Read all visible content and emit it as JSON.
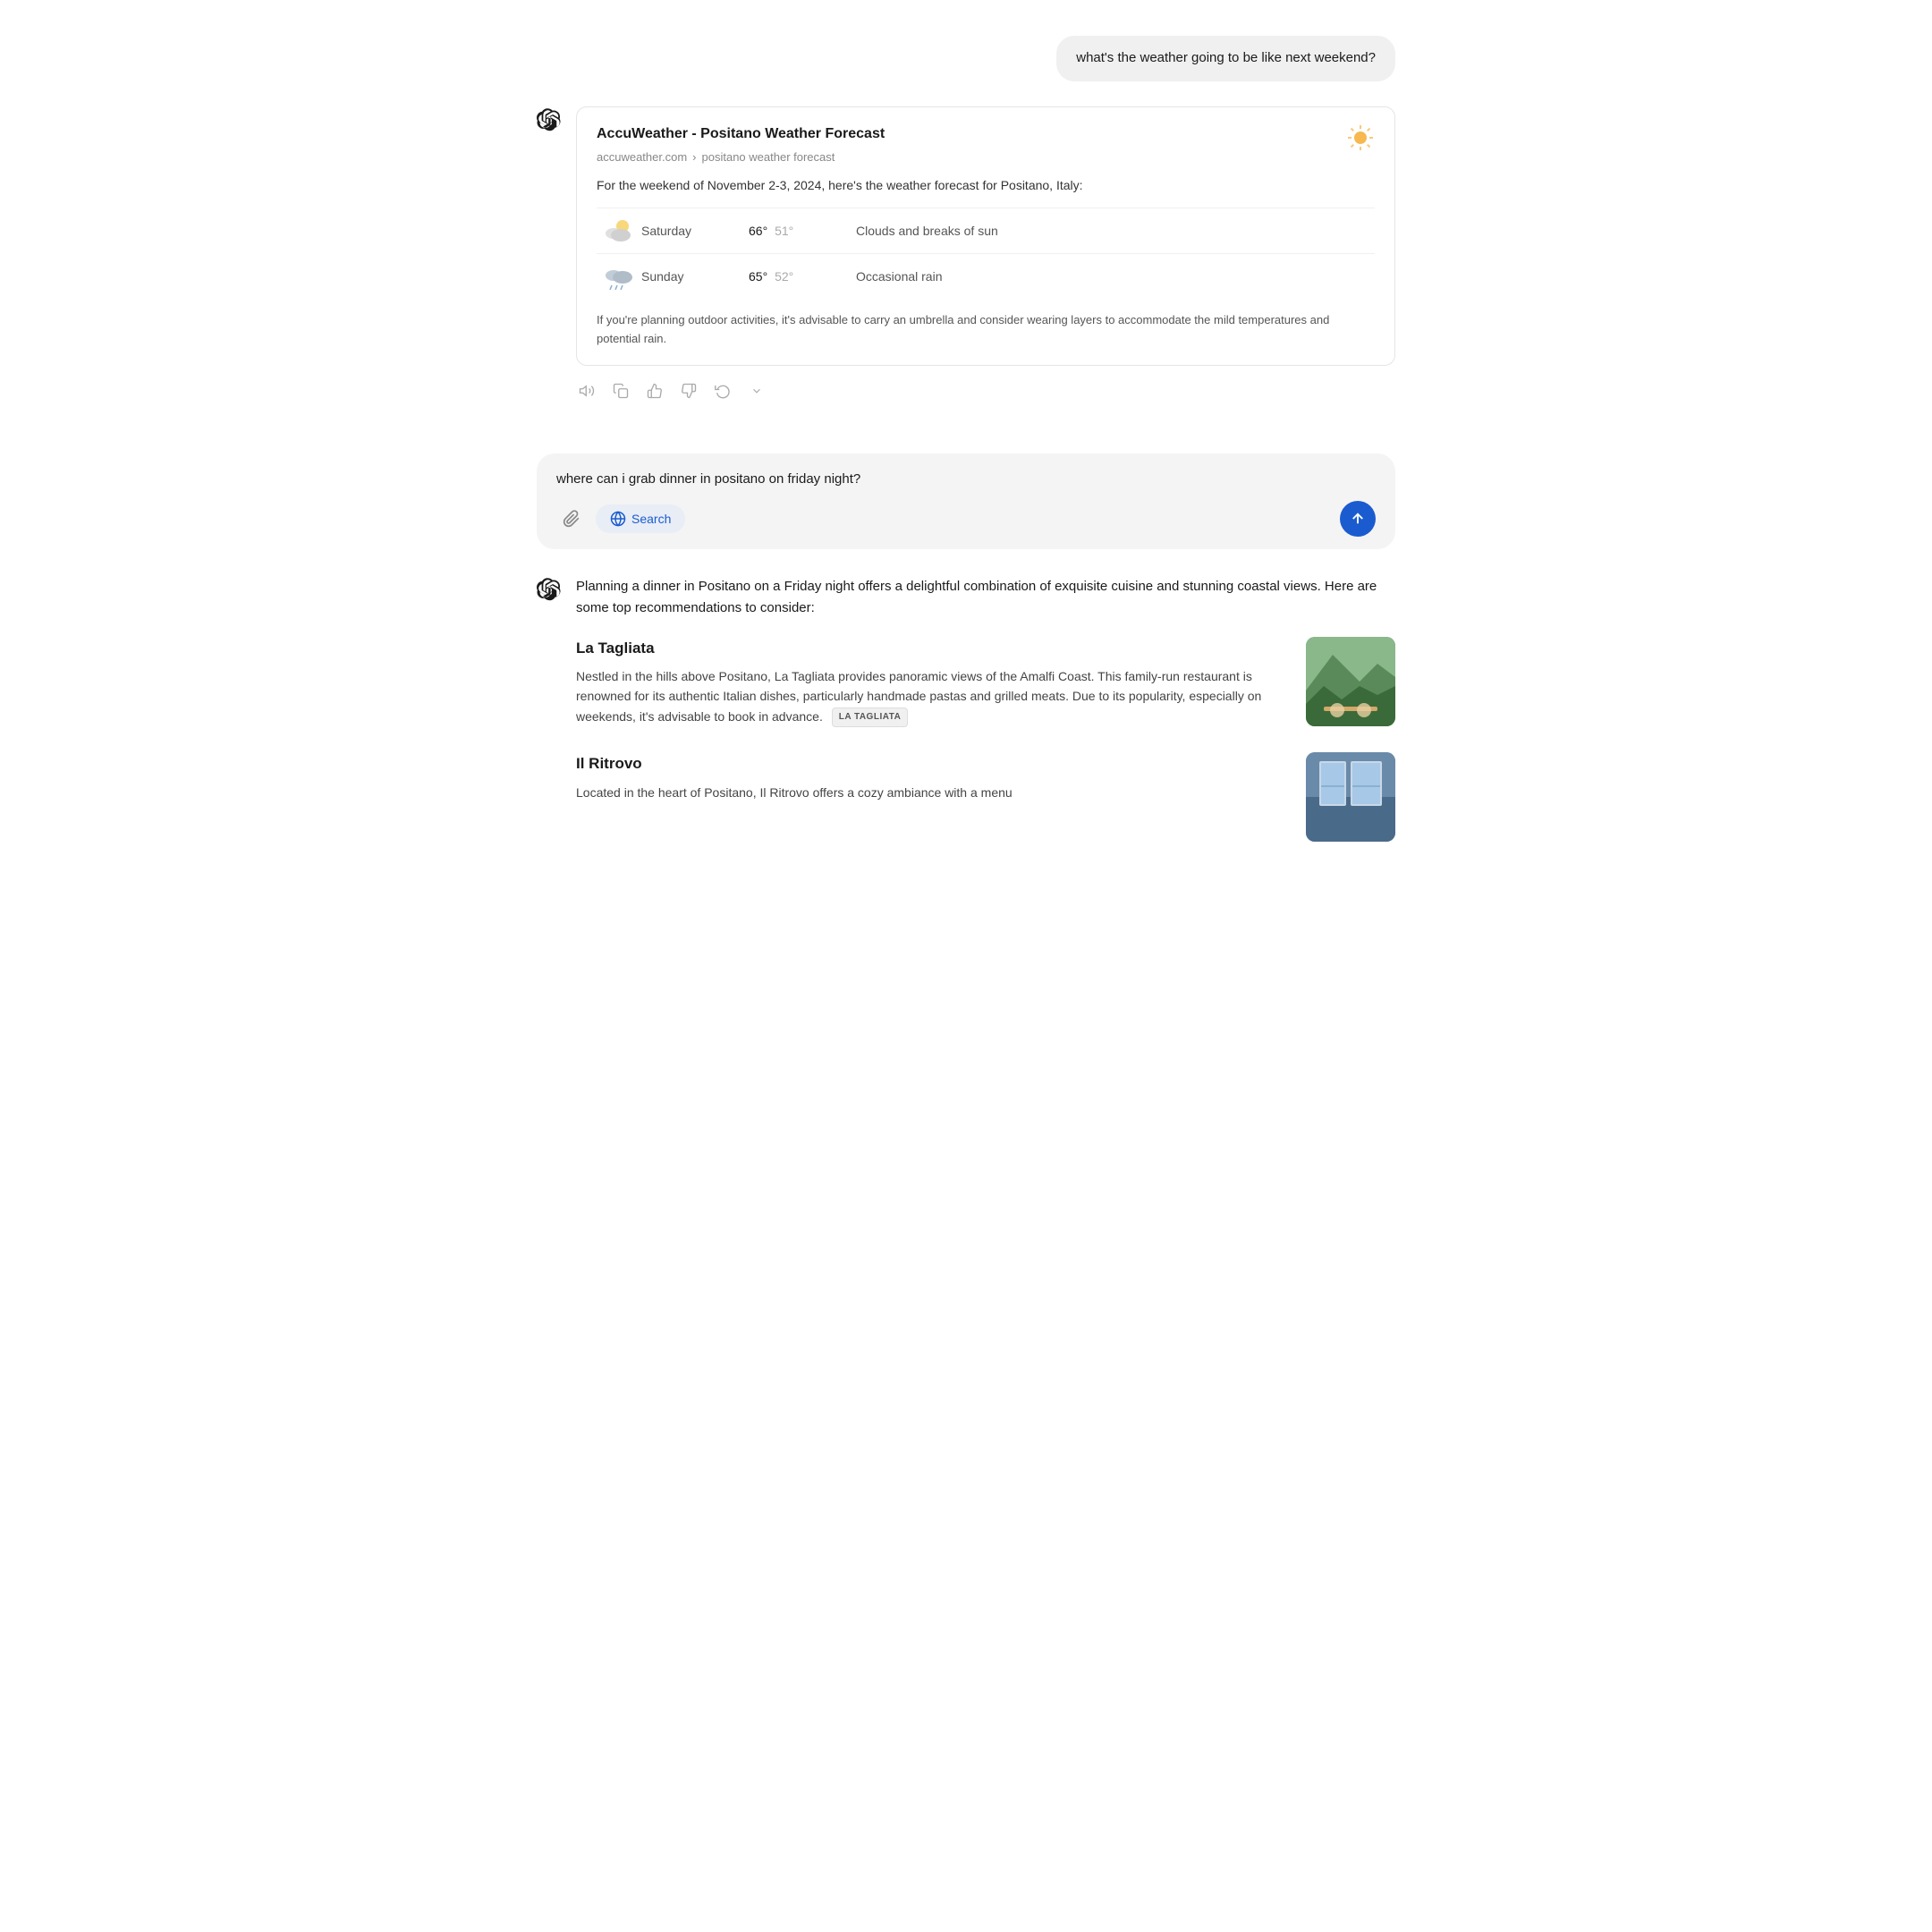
{
  "conversation": {
    "user_message_1": {
      "text": "what's the weather going to be like next weekend?"
    },
    "assistant_response_1": {
      "source_card": {
        "title": "AccuWeather - Positano Weather Forecast",
        "breadcrumb_domain": "accuweather.com",
        "breadcrumb_arrow": "›",
        "breadcrumb_page": "positano weather forecast",
        "intro": "For the weekend of November 2-3, 2024, here's the weather forecast for Positano, Italy:",
        "days": [
          {
            "day": "Saturday",
            "high": "66°",
            "low": "51°",
            "description": "Clouds and breaks of sun"
          },
          {
            "day": "Sunday",
            "high": "65°",
            "low": "52°",
            "description": "Occasional rain"
          }
        ],
        "footer": "If you're planning outdoor activities, it's advisable to carry an umbrella and consider wearing layers to accommodate the mild temperatures and potential rain."
      }
    },
    "user_message_2": {
      "text": "where can i grab dinner in positano on friday night?"
    },
    "assistant_response_2": {
      "intro": "Planning a dinner in Positano on a Friday night offers a delightful combination of exquisite cuisine and stunning coastal views. Here are some top recommendations to consider:",
      "restaurants": [
        {
          "name": "La Tagliata",
          "description": "Nestled in the hills above Positano, La Tagliata provides panoramic views of the Amalfi Coast. This family-run restaurant is renowned for its authentic Italian dishes, particularly handmade pastas and grilled meats. Due to its popularity, especially on weekends, it's advisable to book in advance.",
          "tag": "LA TAGLIATA",
          "image_class": "img-la-tagliata"
        },
        {
          "name": "Il Ritrovo",
          "description": "Located in the heart of Positano, Il Ritrovo offers a cozy ambiance with a menu",
          "tag": "",
          "image_class": "img-il-ritrovo"
        }
      ]
    }
  },
  "input": {
    "current_text": "where can i grab dinner in positano on friday night?",
    "search_label": "Search",
    "attach_title": "Attach",
    "send_title": "Send"
  },
  "icons": {
    "openai_logo": "⊕",
    "sun": "☀",
    "partly_cloudy": "⛅",
    "rainy": "🌧",
    "attach": "📎",
    "globe": "🌐",
    "arrow_up": "↑",
    "speaker": "🔊",
    "copy": "⧉",
    "thumbs_up": "👍",
    "thumbs_down": "👎",
    "refresh": "↻"
  }
}
